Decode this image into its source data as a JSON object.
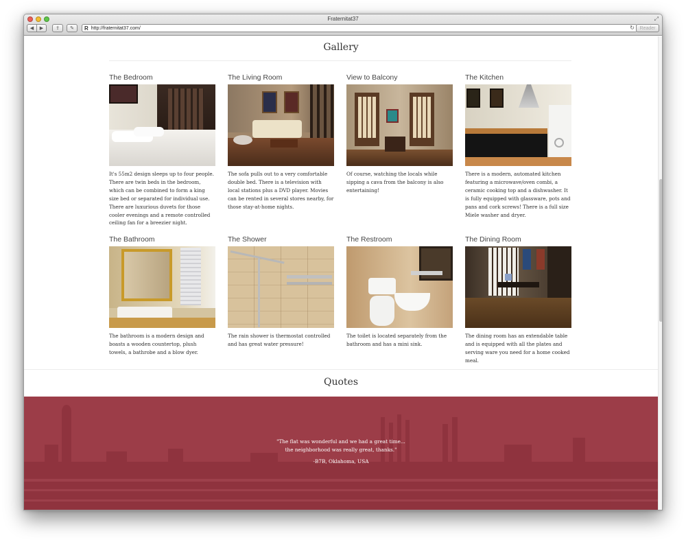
{
  "window": {
    "title": "Fraternitat37",
    "url": "http://fraternitat37.com/",
    "reader_label": "Reader"
  },
  "icons": {
    "back": "back-arrow-icon",
    "forward": "forward-arrow-icon",
    "share": "share-icon",
    "tools": "wrench-icon",
    "reader_r": "R",
    "reload": "reload-icon",
    "resize": "fullscreen-icon"
  },
  "gallery": {
    "title": "Gallery",
    "items": [
      {
        "title": "The Bedroom",
        "text": "It's 55m2 design sleeps up to four people. There are twin beds in the bedroom, which can be combined to form a king size bed or separated for individual use. There are luxurious duvets for those cooler evenings and a remote controlled ceiling fan for a breezier night."
      },
      {
        "title": "The Living Room",
        "text": "The sofa pulls out to a very comfortable double bed. There is a television with local stations plus a DVD player. Movies can be rented in several stores nearby, for those stay-at-home nights."
      },
      {
        "title": "View to Balcony",
        "text": "Of course, watching the locals while sipping a cava from the balcony is also entertaining!"
      },
      {
        "title": "The Kitchen",
        "text": "There is a modern, automated kitchen featuring a microwave/oven combi, a ceramic cooking top and a dishwasher. It is fully equipped with glassware, pots and pans and cork screws! There is a full size Miele washer and dryer."
      },
      {
        "title": "The Bathroom",
        "text": "The bathroom is a modern design and boasts a wooden countertop, plush towels, a bathrobe and a blow dyer."
      },
      {
        "title": "The Shower",
        "text": "The rain shower is thermostat controlled and has great water pressure!"
      },
      {
        "title": "The Restroom",
        "text": "The toilet is located separately from the bathroom and has a mini sink."
      },
      {
        "title": "The Dining Room",
        "text": "The dining room has an extendable table and is equipped with all the plates and serving ware you need for a home cooked meal."
      }
    ]
  },
  "quotes": {
    "title": "Quotes",
    "line1": "\"The flat was wonderful and we had a great time...",
    "line2": "the neighborhood was really great, thanks.\"",
    "author": "-B7B, Oklahoma, USA"
  },
  "colors": {
    "banner": "#9c3d48",
    "chrome": "#d8d8d8"
  }
}
